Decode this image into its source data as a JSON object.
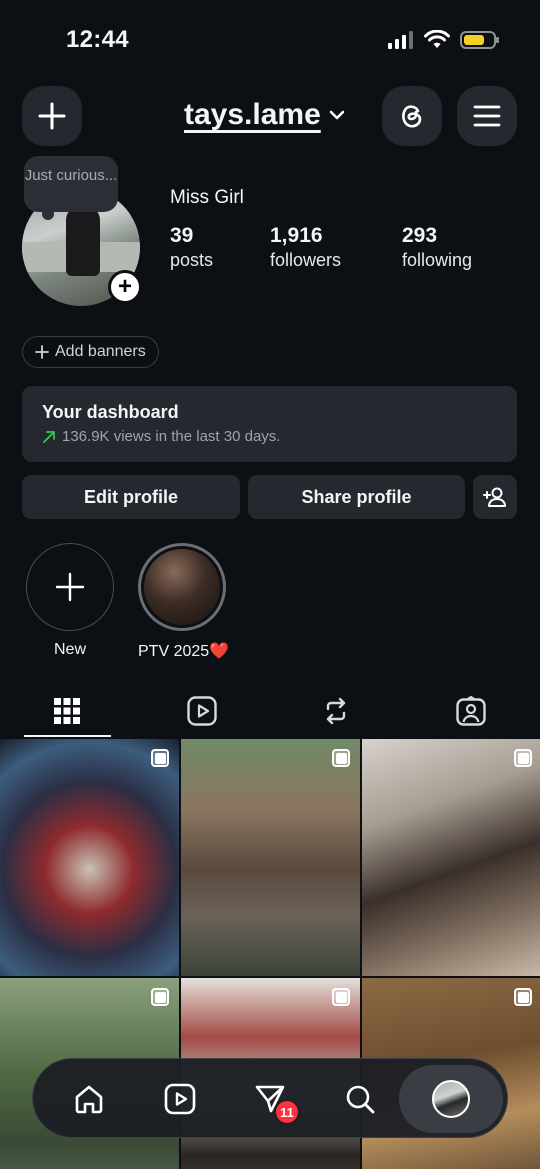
{
  "status_bar": {
    "time": "12:44"
  },
  "header": {
    "username": "tays.lame"
  },
  "profile": {
    "note": "Just curious...",
    "full_name": "Miss Girl",
    "stats": [
      {
        "value": "39",
        "label": "posts"
      },
      {
        "value": "1,916",
        "label": "followers"
      },
      {
        "value": "293",
        "label": "following"
      }
    ],
    "add_banners": "Add banners"
  },
  "dashboard": {
    "title": "Your dashboard",
    "subtitle": "136.9K views in the last 30 days."
  },
  "actions": {
    "edit": "Edit profile",
    "share": "Share profile"
  },
  "highlights": [
    {
      "label": "New"
    },
    {
      "label": "PTV 2025❤️"
    }
  ],
  "tabs": [
    "grid-icon",
    "reels-icon",
    "reposts-icon",
    "tagged-icon"
  ],
  "nav": {
    "messages_badge": "11"
  },
  "colors": {
    "background": "#0c0f14",
    "surface": "#25292f",
    "badge": "#ff3040",
    "trend": "#35c759"
  }
}
